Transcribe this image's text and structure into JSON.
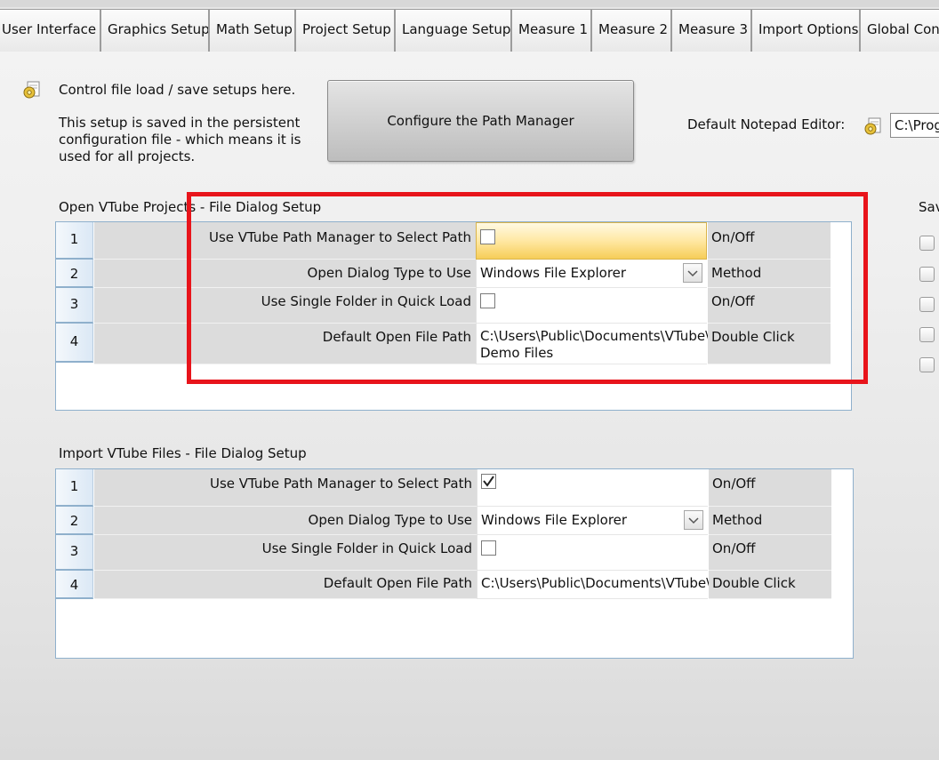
{
  "tabs": [
    {
      "label": "User Interface"
    },
    {
      "label": "Graphics Setup"
    },
    {
      "label": "Math Setup"
    },
    {
      "label": "Project Setup"
    },
    {
      "label": "Language Setup"
    },
    {
      "label": "Measure 1"
    },
    {
      "label": "Measure 2"
    },
    {
      "label": "Measure 3"
    },
    {
      "label": "Import Options"
    },
    {
      "label": "Global Conf"
    }
  ],
  "intro": {
    "line1": "Control file load / save setups here.",
    "para": [
      "This setup is saved in the persistent",
      "configuration file - which means it is",
      "used for all projects."
    ]
  },
  "configure_button": "Configure the Path Manager",
  "notepad": {
    "label": "Default Notepad Editor:",
    "value": "C:\\Prog"
  },
  "side_title": "Sav",
  "section1": {
    "title": "Open VTube Projects - File Dialog Setup",
    "rows": [
      {
        "num": "1",
        "label": "Use VTube Path Manager to Select Path",
        "type": "On/Off",
        "checked": false
      },
      {
        "num": "2",
        "label": "Open Dialog Type to Use",
        "value": "Windows File Explorer",
        "type": "Method"
      },
      {
        "num": "3",
        "label": "Use Single Folder in Quick Load",
        "type": "On/Off",
        "checked": false
      },
      {
        "num": "4",
        "label": "Default Open File Path",
        "value_line1": "C:\\Users\\Public\\Documents\\VTube\\",
        "value_line2": "Demo Files",
        "type": "Double Click"
      }
    ]
  },
  "section2": {
    "title": "Import VTube Files - File Dialog Setup",
    "rows": [
      {
        "num": "1",
        "label": "Use VTube Path Manager to Select Path",
        "type": "On/Off",
        "checked": true
      },
      {
        "num": "2",
        "label": "Open Dialog Type to Use",
        "value": "Windows File Explorer",
        "type": "Method"
      },
      {
        "num": "3",
        "label": "Use Single Folder in Quick Load",
        "type": "On/Off",
        "checked": false
      },
      {
        "num": "4",
        "label": "Default Open File Path",
        "value": "C:\\Users\\Public\\Documents\\VTube\\",
        "type": "Double Click"
      }
    ]
  },
  "colors": {
    "highlight_box": "#e8141b",
    "grid_border": "#8fb0cc",
    "active_cell": "#f6cd58"
  }
}
